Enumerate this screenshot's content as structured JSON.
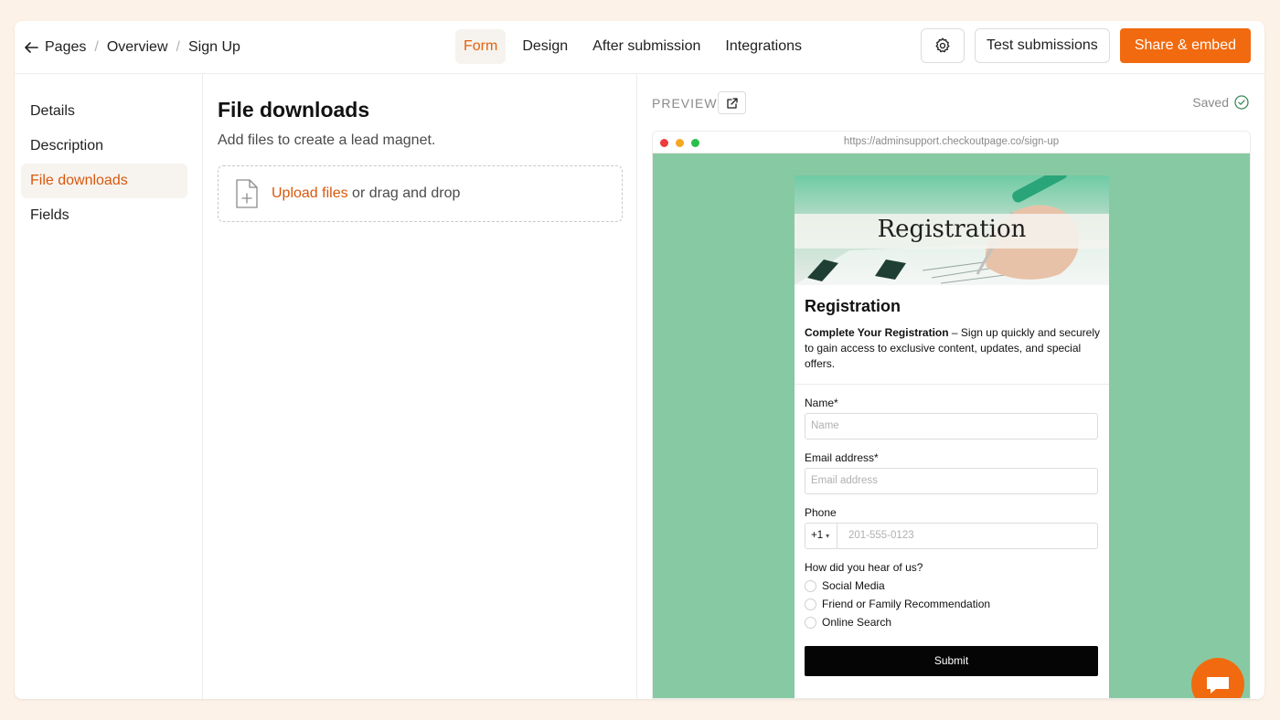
{
  "breadcrumb": {
    "items": [
      "Pages",
      "Overview",
      "Sign Up"
    ]
  },
  "tabs": [
    "Form",
    "Design",
    "After submission",
    "Integrations"
  ],
  "actions": {
    "test_label": "Test submissions",
    "share_label": "Share & embed"
  },
  "sidebar": {
    "items": [
      "Details",
      "Description",
      "File downloads",
      "Fields"
    ]
  },
  "main": {
    "title": "File downloads",
    "subtitle": "Add files to create a lead magnet.",
    "upload_link": "Upload files",
    "upload_rest": " or drag and drop"
  },
  "preview": {
    "label": "PREVIEW",
    "status": "Saved",
    "url": "https://adminsupport.checkoutpage.co/sign-up",
    "hero_title": "Registration",
    "form_title": "Registration",
    "desc_bold": "Complete Your Registration",
    "desc_rest": " – Sign up quickly and securely to gain access to exclusive content, updates, and special offers.",
    "fields": {
      "name_label": "Name",
      "name_placeholder": "Name",
      "email_label": "Email address",
      "email_placeholder": "Email address",
      "phone_label": "Phone",
      "phone_code": "+1",
      "phone_placeholder": "201-555-0123",
      "required_mark": "*"
    },
    "question": "How did you hear of us?",
    "options": [
      "Social Media",
      "Friend or Family Recommendation",
      "Online Search"
    ],
    "submit_label": "Submit"
  },
  "colors": {
    "accent": "#f26a0f",
    "preview_bg": "#87c9a3"
  }
}
